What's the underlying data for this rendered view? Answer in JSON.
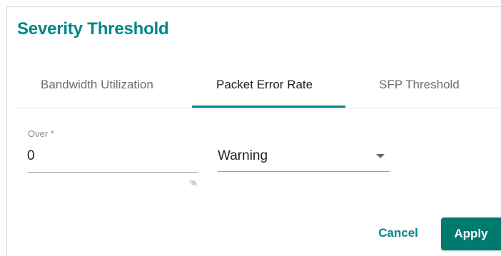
{
  "dialog": {
    "title": "Severity Threshold"
  },
  "tabs": [
    {
      "label": "Bandwidth Utilization",
      "active": false
    },
    {
      "label": "Packet Error Rate",
      "active": true
    },
    {
      "label": "SFP Threshold",
      "active": false
    }
  ],
  "form": {
    "over_label": "Over *",
    "over_value": "0",
    "over_suffix": "%",
    "severity_value": "Warning"
  },
  "actions": {
    "cancel_label": "Cancel",
    "apply_label": "Apply"
  },
  "colors": {
    "accent": "#008787",
    "apply_bg": "#007a6e"
  },
  "icons": {
    "select_caret": "caret-down-icon"
  }
}
